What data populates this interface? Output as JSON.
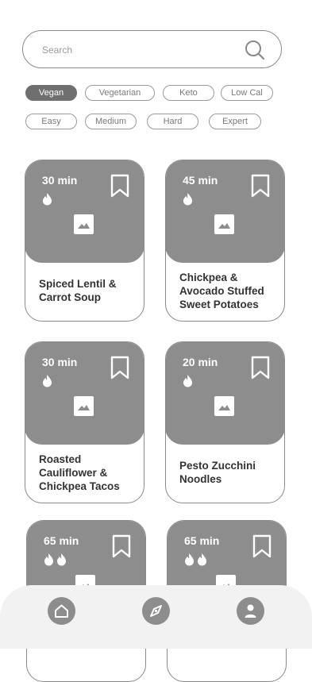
{
  "search": {
    "placeholder": "Search",
    "icon": "search-icon"
  },
  "filters": {
    "diet": [
      "Vegan",
      "Vegetarian",
      "Keto",
      "Low Cal"
    ],
    "difficulty": [
      "Easy",
      "Medium",
      "Hard",
      "Expert"
    ],
    "active": "Vegan"
  },
  "recipes": [
    {
      "time": "30 min",
      "flames": 1,
      "title": "Spiced Lentil & Carrot Soup"
    },
    {
      "time": "45 min",
      "flames": 1,
      "title": "Chickpea & Avocado Stuffed Sweet Potatoes"
    },
    {
      "time": "30 min",
      "flames": 1,
      "title": "Roasted Cauliflower & Chickpea Tacos"
    },
    {
      "time": "20 min",
      "flames": 1,
      "title": "Pesto Zucchini Noodles"
    },
    {
      "time": "65 min",
      "flames": 2,
      "title": ""
    },
    {
      "time": "65 min",
      "flames": 2,
      "title": ""
    }
  ],
  "nav": {
    "items": [
      "home-icon",
      "explore-icon",
      "profile-icon"
    ]
  },
  "colors": {
    "card": "#8d8d8d",
    "chip_active": "#6f6f6f",
    "nav_bg": "#f2f2f2"
  }
}
